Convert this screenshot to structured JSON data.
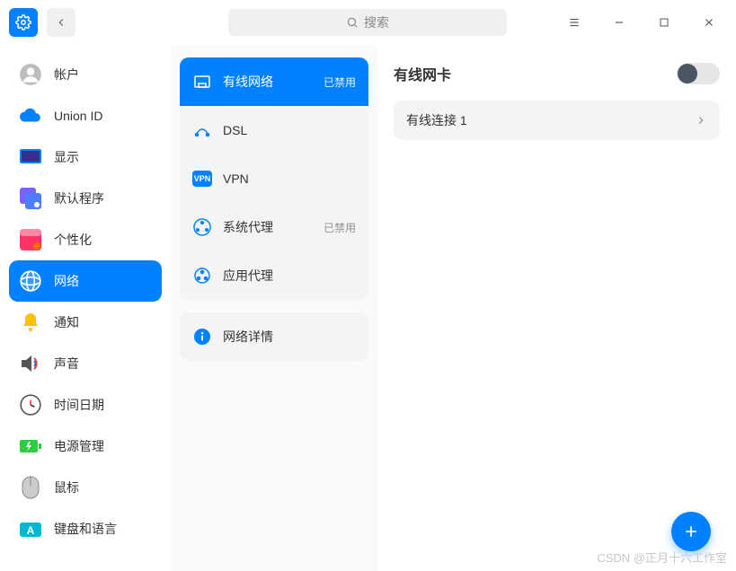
{
  "search": {
    "placeholder": "搜索"
  },
  "sidebar": {
    "items": [
      {
        "label": "帐户"
      },
      {
        "label": "Union ID"
      },
      {
        "label": "显示"
      },
      {
        "label": "默认程序"
      },
      {
        "label": "个性化"
      },
      {
        "label": "网络"
      },
      {
        "label": "通知"
      },
      {
        "label": "声音"
      },
      {
        "label": "时间日期"
      },
      {
        "label": "电源管理"
      },
      {
        "label": "鼠标"
      },
      {
        "label": "键盘和语言"
      }
    ],
    "active_index": 5
  },
  "network_menu": {
    "items": [
      {
        "label": "有线网络",
        "status": "已禁用"
      },
      {
        "label": "DSL",
        "status": ""
      },
      {
        "label": "VPN",
        "status": ""
      },
      {
        "label": "系统代理",
        "status": "已禁用"
      },
      {
        "label": "应用代理",
        "status": ""
      },
      {
        "label": "网络详情",
        "status": ""
      }
    ],
    "active_index": 0,
    "vpn_badge": "VPN"
  },
  "main": {
    "title": "有线网卡",
    "toggle_on": false,
    "connections": [
      {
        "label": "有线连接 1"
      }
    ]
  },
  "watermark": "CSDN @正月十六工作室"
}
